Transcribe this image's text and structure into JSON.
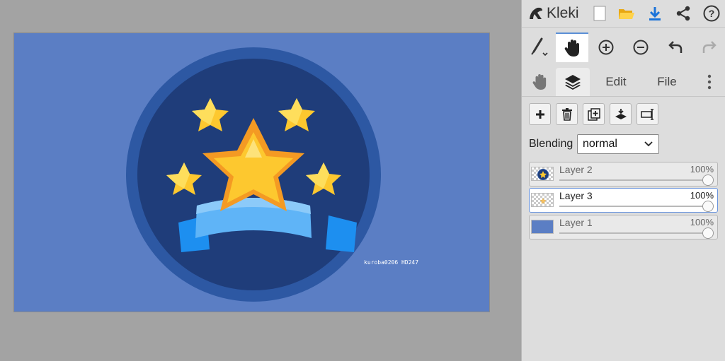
{
  "app": {
    "name": "Kleki"
  },
  "colors": {
    "canvas_bg": "#5b7ec4",
    "badge_outer": "#2d58a3",
    "badge_inner": "#1f3d7a",
    "star_yellow": "#fdc82f",
    "star_orange": "#f49a23",
    "ribbon_blue": "#4aa8f5",
    "accent": "#5b8fd6"
  },
  "top_icons": [
    "new-image-icon",
    "open-folder-icon",
    "download-icon",
    "share-icon",
    "help-icon"
  ],
  "tools": [
    "brush-tool",
    "hand-tool",
    "zoom-in",
    "zoom-out",
    "undo",
    "redo"
  ],
  "tabs": {
    "edit": "Edit",
    "file": "File"
  },
  "layer_actions": [
    "add-layer",
    "delete-layer",
    "duplicate-layer",
    "merge-down",
    "rename-layer"
  ],
  "blending": {
    "label": "Blending",
    "value": "normal"
  },
  "layers": [
    {
      "name": "Layer 2",
      "opacity": "100%"
    },
    {
      "name": "Layer 3",
      "opacity": "100%"
    },
    {
      "name": "Layer 1",
      "opacity": "100%"
    }
  ],
  "canvas": {
    "watermark": "kuroba0206 HD247"
  }
}
